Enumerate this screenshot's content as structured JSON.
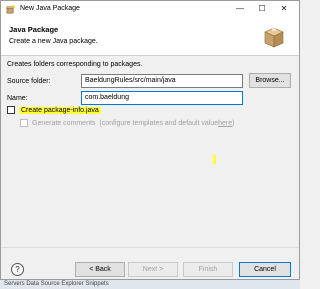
{
  "window": {
    "title": "New Java Package",
    "icon": "new-package-icon",
    "controls": {
      "minimize": "—",
      "maximize": "☐",
      "close": "✕"
    }
  },
  "header": {
    "title": "Java Package",
    "description": "Create a new Java package.",
    "image": "package-wizard-icon"
  },
  "body": {
    "description": "Creates folders corresponding to packages.",
    "source_folder": {
      "label": "Source folder:",
      "value": "BaeldungRules/src/main/java",
      "browse_label": "Browse..."
    },
    "name": {
      "label": "Name:",
      "value": "com.baeldung"
    },
    "create_package_info": {
      "label": "Create package-info.java",
      "checked": false
    },
    "generate_comments": {
      "label": "Generate comments",
      "hint_prefix": "(configure templates and default value ",
      "hint_link": "here",
      "hint_suffix": ")",
      "enabled": false
    }
  },
  "footer": {
    "help_icon": "help-icon",
    "help_glyph": "?",
    "back_label": "< Back",
    "next_label": "Next >",
    "finish_label": "Finish",
    "cancel_label": "Cancel"
  },
  "background_strip": "Servers   Data Source Explorer   Snippets",
  "colors": {
    "highlight": "#ffff33",
    "focus": "#0078d7"
  }
}
